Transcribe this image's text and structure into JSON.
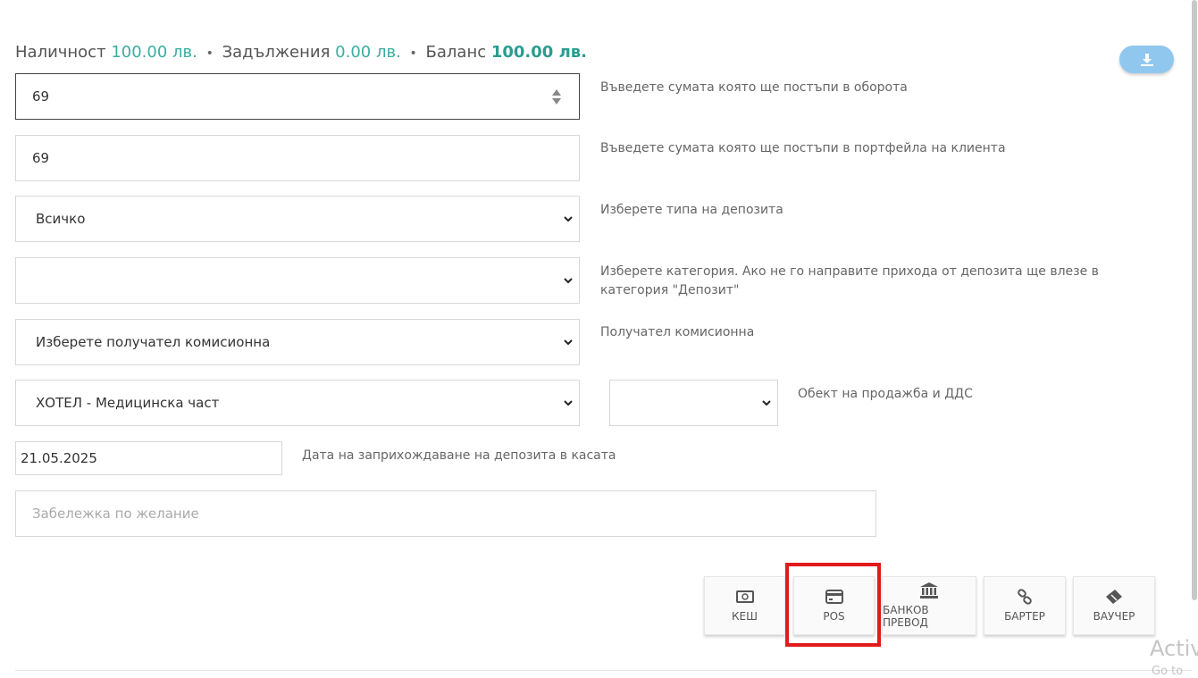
{
  "summary": {
    "availability_label": "Наличност",
    "availability_value": "100.00 лв.",
    "debts_label": "Задължения",
    "debts_value": "0.00 лв.",
    "balance_label": "Баланс",
    "balance_value": "100.00 лв.",
    "separator": "•"
  },
  "download_button": {
    "icon": "download-icon"
  },
  "form": {
    "turnover_amount": {
      "value": "69",
      "hint": "Въведете сумата която ще постъпи в оборота"
    },
    "wallet_amount": {
      "value": "69",
      "hint": "Въведете сумата която ще постъпи в портфейла на клиента"
    },
    "deposit_type": {
      "selected": "Всичко",
      "hint": "Изберете типа на депозита"
    },
    "category": {
      "selected": "",
      "hint": "Изберете категория. Ако не го направите прихода от депозита ще влезе в категория \"Депозит\""
    },
    "commission_recipient": {
      "selected": "Изберете получател комисионна",
      "hint": "Получател комисионна"
    },
    "sale_object": {
      "selected": "ХОТЕЛ - Медицинска част",
      "hint": "Обект на продажба и ДДС"
    },
    "vat": {
      "selected": ""
    },
    "deposit_date": {
      "value": "21.05.2025",
      "hint": "Дата на заприхождаване на депозита в касата"
    },
    "note": {
      "placeholder": "Забележка по желание"
    }
  },
  "payment_methods": [
    {
      "label": "КЕШ",
      "icon": "cash-icon"
    },
    {
      "label": "POS",
      "icon": "credit-card-icon"
    },
    {
      "label": "БАНКОВ ПРЕВОД",
      "icon": "bank-icon"
    },
    {
      "label": "БАРТЕР",
      "icon": "link-icon"
    },
    {
      "label": "ВАУЧЕР",
      "icon": "ticket-icon"
    }
  ],
  "watermark": {
    "line1": "Activ",
    "line2": "Go to"
  },
  "colors": {
    "accent": "#2a9d8f",
    "highlight": "#e11b1b",
    "download": "#8fc7ee"
  }
}
